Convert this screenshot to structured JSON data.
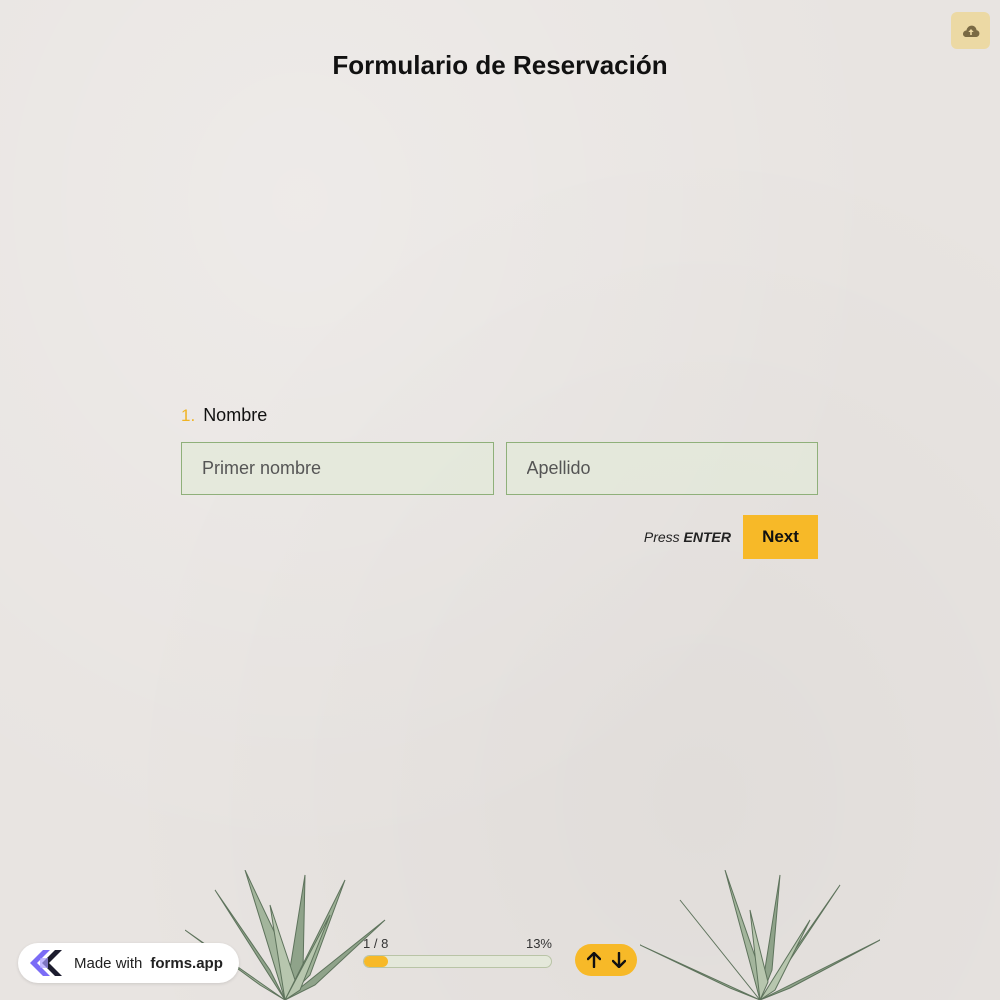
{
  "form": {
    "title": "Formulario de Reservación"
  },
  "question": {
    "number": "1.",
    "label": "Nombre",
    "first_name": {
      "value": "",
      "placeholder": "Primer nombre"
    },
    "last_name": {
      "value": "",
      "placeholder": "Apellido"
    }
  },
  "actions": {
    "press_hint": "Press",
    "press_key": "ENTER",
    "next_label": "Next"
  },
  "footer": {
    "brand_prefix": "Made with",
    "brand_name": "forms.app",
    "progress_step": "1 / 8",
    "progress_percent": "13%",
    "progress_fraction": 0.13
  },
  "icons": {
    "save": "cloud-upload-icon",
    "brand_logo": "forms-app-logo-icon",
    "prev": "arrow-up-icon",
    "next": "arrow-down-icon"
  },
  "colors": {
    "accent": "#f7b928",
    "background": "#e8e4e1",
    "input_bg": "#e2e9d8",
    "input_border": "#8fb07a",
    "save_button": "#ecd9a4"
  }
}
